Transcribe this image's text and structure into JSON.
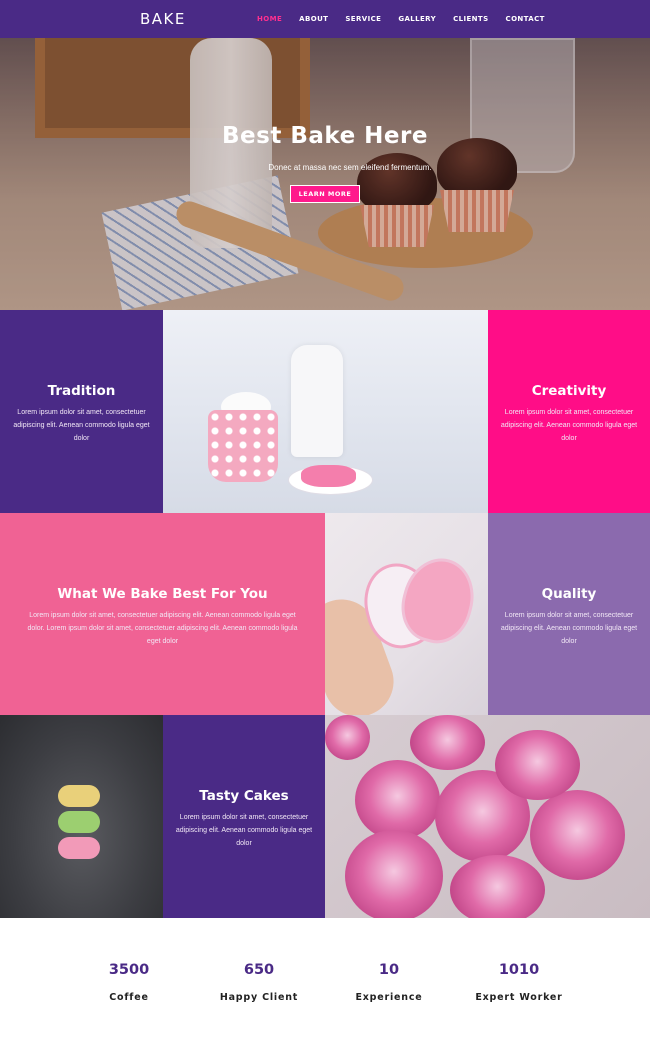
{
  "nav": {
    "brand": "BAKE",
    "items": [
      {
        "label": "HOME",
        "active": true
      },
      {
        "label": "ABOUT",
        "active": false
      },
      {
        "label": "SERVICE",
        "active": false
      },
      {
        "label": "GALLERY",
        "active": false
      },
      {
        "label": "CLIENTS",
        "active": false
      },
      {
        "label": "CONTACT",
        "active": false
      }
    ]
  },
  "hero": {
    "title": "Best Bake Here",
    "subtitle": "Donec at massa nec sem eleifend fermentum.",
    "button": "LEARN MORE"
  },
  "features": {
    "tradition": {
      "title": "Tradition",
      "text": "Lorem ipsum dolor sit amet, consectetuer adipiscing elit. Aenean commodo ligula eget dolor"
    },
    "creativity": {
      "title": "Creativity",
      "text": "Lorem ipsum dolor sit amet, consectetuer adipiscing elit. Aenean commodo ligula eget dolor"
    },
    "bake_best": {
      "title": "What We Bake Best For You",
      "text": "Lorem ipsum dolor sit amet, consectetuer adipiscing elit. Aenean commodo ligula eget dolor. Lorem ipsum dolor sit amet, consectetuer adipiscing elit. Aenean commodo ligula eget dolor"
    },
    "quality": {
      "title": "Quality",
      "text": "Lorem ipsum dolor sit amet, consectetuer adipiscing elit. Aenean commodo ligula eget dolor"
    },
    "tasty": {
      "title": "Tasty Cakes",
      "text": "Lorem ipsum dolor sit amet, consectetuer adipiscing elit. Aenean commodo ligula eget dolor"
    }
  },
  "stats": [
    {
      "value": "3500",
      "label": "Coffee"
    },
    {
      "value": "650",
      "label": "Happy Client"
    },
    {
      "value": "10",
      "label": "Experience"
    },
    {
      "value": "1010",
      "label": "Expert Worker"
    }
  ],
  "colors": {
    "purple": "#4a2a86",
    "pink": "#ff1a8c",
    "rose": "#f06292",
    "lavender": "#8868b0"
  }
}
